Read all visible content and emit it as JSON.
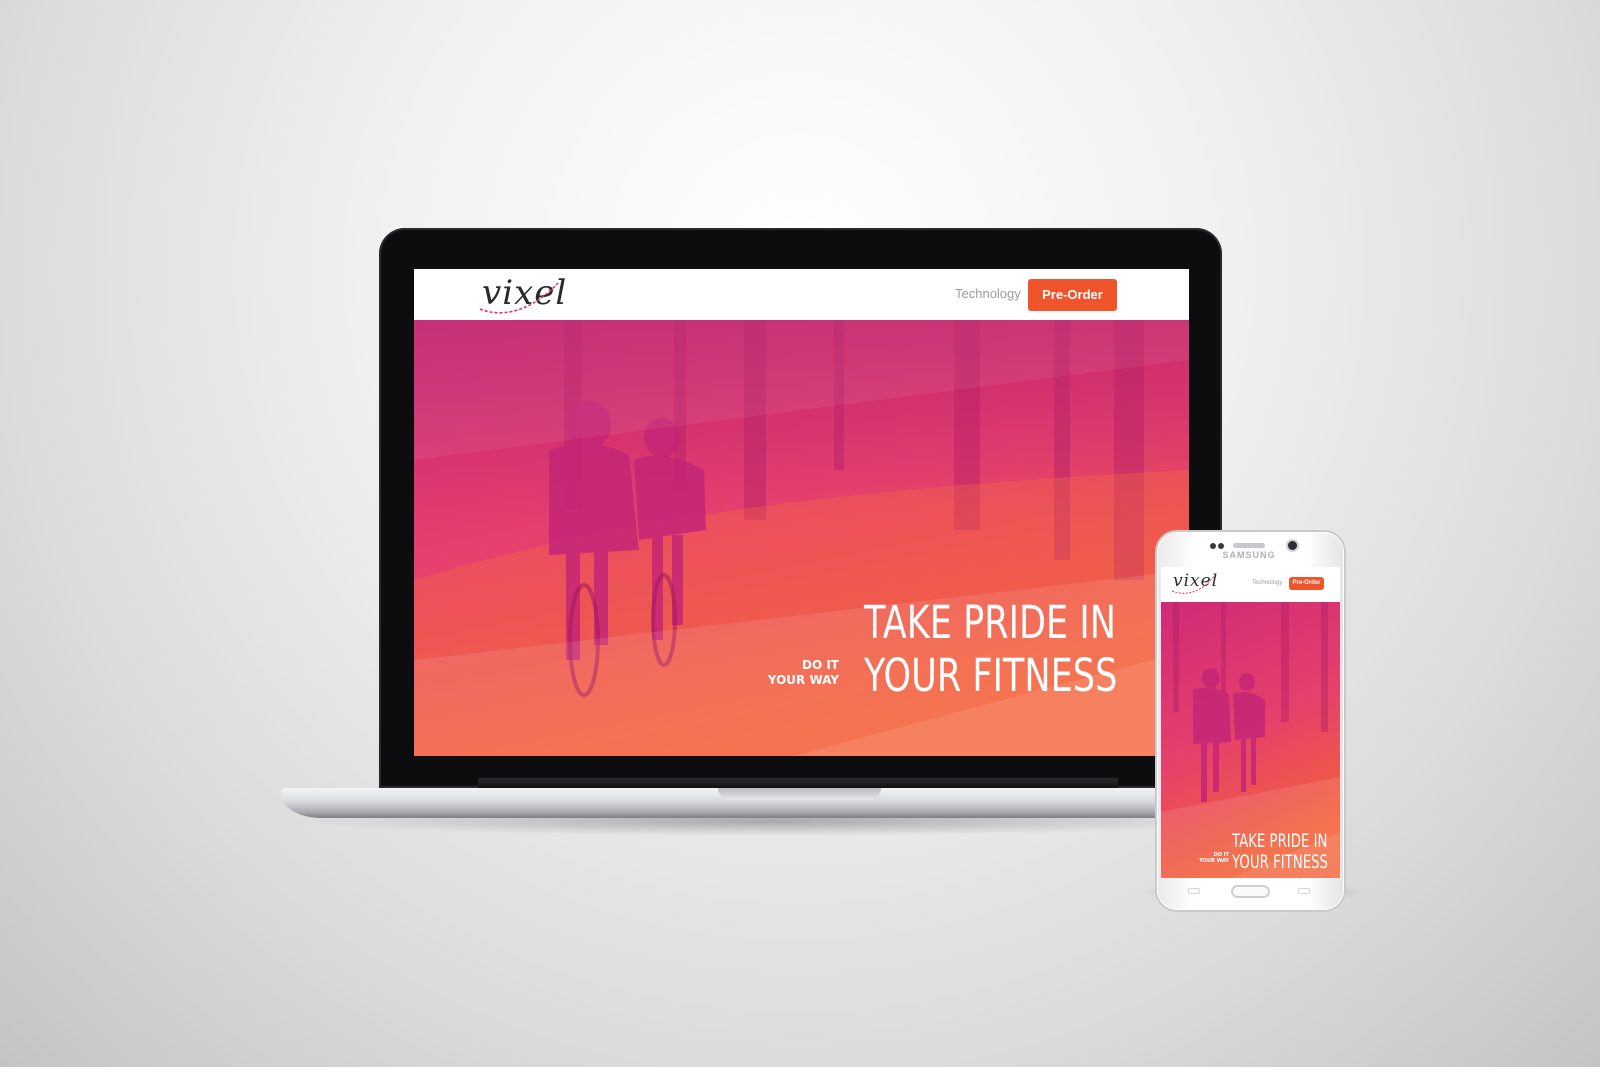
{
  "brand": {
    "logo_text": "vixel"
  },
  "nav": {
    "technology_label": "Technology",
    "preorder_label": "Pre-Order"
  },
  "hero": {
    "headline_line1": "TAKE PRIDE IN",
    "headline_line2": "YOUR FITNESS",
    "tagline_line1": "DO IT",
    "tagline_line2": "YOUR WAY"
  },
  "phone": {
    "brand_text": "SAMSUNG"
  },
  "colors": {
    "accent": "#f0542a",
    "hero_magenta": "#d6307d",
    "hero_orange": "#f2633a"
  }
}
